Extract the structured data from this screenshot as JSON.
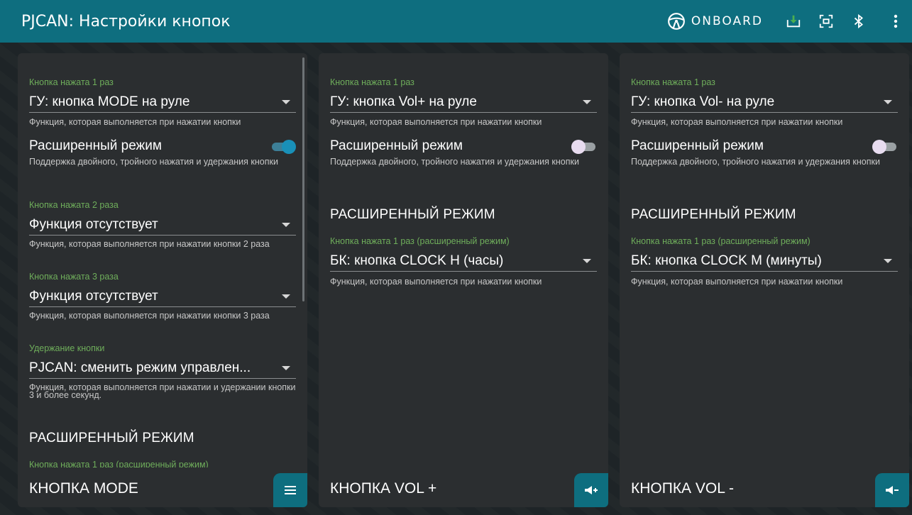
{
  "app": {
    "title": "PJCAN: Настройки кнопок",
    "onboard_label": "ONBOARD"
  },
  "icons": {
    "onboard": "steering-wheel-icon",
    "download": "download-icon",
    "fullscreen": "fullscreen-icon",
    "bluetooth": "bluetooth-icon",
    "more": "more-vertical-icon"
  },
  "colors": {
    "accent": "#0e6e7f",
    "label_green": "#6fae5b",
    "card_bg": "#2b2e30",
    "download_icon": "#4caf50"
  },
  "cards": [
    {
      "title": "КНОПКА MODE",
      "fab_icon": "menu-icon",
      "press1": {
        "label": "Кнопка нажата 1 раз",
        "value": "ГУ: кнопка MODE на руле",
        "helper": "Функция, которая выполняется при нажатии кнопки"
      },
      "extended": {
        "label": "Расширенный режим",
        "on": true,
        "helper": "Поддержка двойного, тройного нажатия и удержания кнопки"
      },
      "press2": {
        "label": "Кнопка нажата 2 раза",
        "value": "Функция отсутствует",
        "helper": "Функция, которая выполняется при нажатии кнопки 2 раза"
      },
      "press3": {
        "label": "Кнопка нажата 3 раза",
        "value": "Функция отсутствует",
        "helper": "Функция, которая выполняется при нажатии кнопки 3 раза"
      },
      "hold": {
        "label": "Удержание кнопки",
        "value": "PJCAN: сменить режим управлен...",
        "helper": "Функция, которая выполняется при нажатии и удержании кнопки 3 и более секунд."
      },
      "section": "РАСШИРЕННЫЙ РЕЖИМ",
      "ext_press1_label": "Кнопка нажата 1 раз (расширенный режим)"
    },
    {
      "title": "КНОПКА VOL +",
      "fab_icon": "volume-up-icon",
      "press1": {
        "label": "Кнопка нажата 1 раз",
        "value": "ГУ: кнопка Vol+ на руле",
        "helper": "Функция, которая выполняется при нажатии кнопки"
      },
      "extended": {
        "label": "Расширенный режим",
        "on": false,
        "helper": "Поддержка двойного, тройного нажатия и удержания кнопки"
      },
      "section": "РАСШИРЕННЫЙ РЕЖИМ",
      "ext_press1": {
        "label": "Кнопка нажата 1 раз (расширенный режим)",
        "value": "БК: кнопка CLOCK H (часы)",
        "helper": "Функция, которая выполняется при нажатии кнопки"
      }
    },
    {
      "title": "КНОПКА VOL -",
      "fab_icon": "volume-down-icon",
      "press1": {
        "label": "Кнопка нажата 1 раз",
        "value": "ГУ: кнопка Vol- на руле",
        "helper": "Функция, которая выполняется при нажатии кнопки"
      },
      "extended": {
        "label": "Расширенный режим",
        "on": false,
        "helper": "Поддержка двойного, тройного нажатия и удержания кнопки"
      },
      "section": "РАСШИРЕННЫЙ РЕЖИМ",
      "ext_press1": {
        "label": "Кнопка нажата 1 раз (расширенный режим)",
        "value": "БК: кнопка CLOCK M (минуты)",
        "helper": "Функция, которая выполняется при нажатии кнопки"
      }
    }
  ]
}
